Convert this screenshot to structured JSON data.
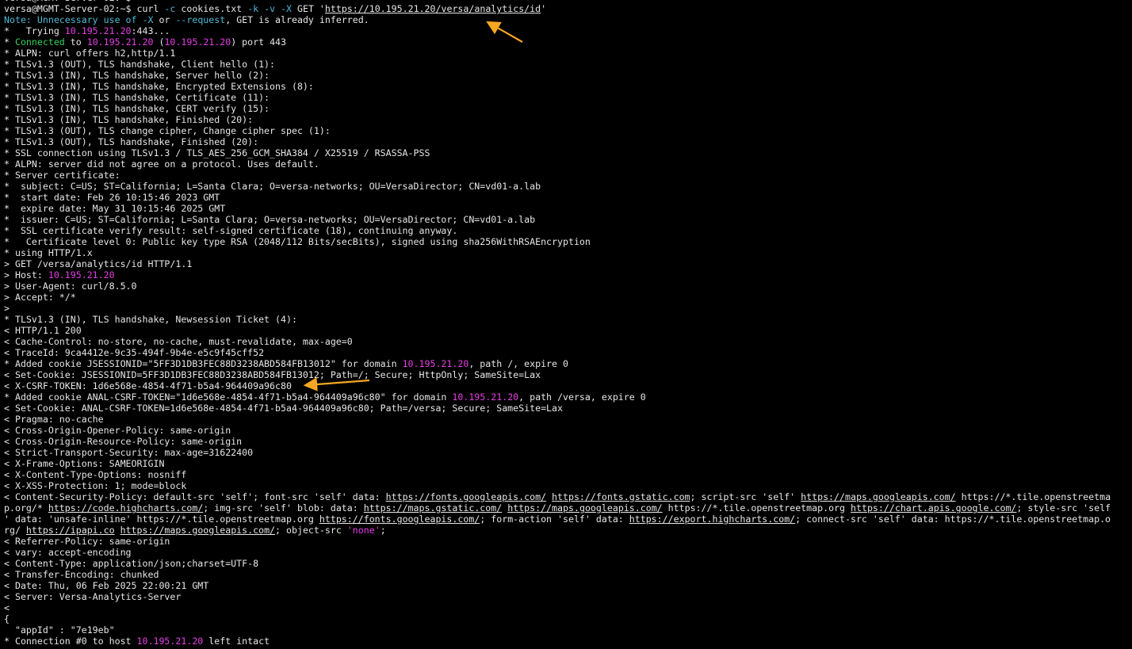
{
  "terminal": {
    "lines": [
      [
        {
          "t": "versa@MGMT-Server-02:~$ ",
          "c": "prompt"
        }
      ],
      [
        {
          "t": "versa@MGMT-Server-02:~$ curl ",
          "c": "prompt"
        },
        {
          "t": "-c",
          "c": "flag"
        },
        {
          "t": " cookies.txt ",
          "c": "plain"
        },
        {
          "t": "-k",
          "c": "flag"
        },
        {
          "t": " ",
          "c": "plain"
        },
        {
          "t": "-v",
          "c": "flag"
        },
        {
          "t": " ",
          "c": "plain"
        },
        {
          "t": "-X",
          "c": "flag"
        },
        {
          "t": " GET '",
          "c": "plain"
        },
        {
          "t": "https://10.195.21.20/versa/analytics/id",
          "c": "link"
        },
        {
          "t": "'",
          "c": "plain"
        }
      ],
      [
        {
          "t": "Note: Unnecessary use of ",
          "c": "note"
        },
        {
          "t": "-X",
          "c": "flag"
        },
        {
          "t": " or ",
          "c": "plain"
        },
        {
          "t": "--request",
          "c": "flag"
        },
        {
          "t": ", GET is already inferred.",
          "c": "plain"
        }
      ],
      [
        {
          "t": "*   Trying ",
          "c": "plain"
        },
        {
          "t": "10.195.21.20",
          "c": "ip"
        },
        {
          "t": ":443...",
          "c": "plain"
        }
      ],
      [
        {
          "t": "* ",
          "c": "plain"
        },
        {
          "t": "Connected",
          "c": "green"
        },
        {
          "t": " to ",
          "c": "plain"
        },
        {
          "t": "10.195.21.20",
          "c": "ip"
        },
        {
          "t": " (",
          "c": "plain"
        },
        {
          "t": "10.195.21.20",
          "c": "ip"
        },
        {
          "t": ") port 443",
          "c": "plain"
        }
      ],
      [
        {
          "t": "* ALPN: curl offers h2,http/1.1",
          "c": "plain"
        }
      ],
      [
        {
          "t": "* TLSv1.3 (OUT), TLS handshake, Client hello (1):",
          "c": "plain"
        }
      ],
      [
        {
          "t": "* TLSv1.3 (IN), TLS handshake, Server hello (2):",
          "c": "plain"
        }
      ],
      [
        {
          "t": "* TLSv1.3 (IN), TLS handshake, Encrypted Extensions (8):",
          "c": "plain"
        }
      ],
      [
        {
          "t": "* TLSv1.3 (IN), TLS handshake, Certificate (11):",
          "c": "plain"
        }
      ],
      [
        {
          "t": "* TLSv1.3 (IN), TLS handshake, CERT verify (15):",
          "c": "plain"
        }
      ],
      [
        {
          "t": "* TLSv1.3 (IN), TLS handshake, Finished (20):",
          "c": "plain"
        }
      ],
      [
        {
          "t": "* TLSv1.3 (OUT), TLS change cipher, Change cipher spec (1):",
          "c": "plain"
        }
      ],
      [
        {
          "t": "* TLSv1.3 (OUT), TLS handshake, Finished (20):",
          "c": "plain"
        }
      ],
      [
        {
          "t": "* SSL connection using TLSv1.3 / TLS_AES_256_GCM_SHA384 / X25519 / RSASSA-PSS",
          "c": "plain"
        }
      ],
      [
        {
          "t": "* ALPN: server did not agree on a protocol. Uses default.",
          "c": "plain"
        }
      ],
      [
        {
          "t": "* Server certificate:",
          "c": "plain"
        }
      ],
      [
        {
          "t": "*  subject: C=US; ST=California; L=Santa Clara; O=versa-networks; OU=VersaDirector; CN=vd01-a.lab",
          "c": "plain"
        }
      ],
      [
        {
          "t": "*  start date: Feb 26 10:15:46 2023 GMT",
          "c": "plain"
        }
      ],
      [
        {
          "t": "*  expire date: May 31 10:15:46 2025 GMT",
          "c": "plain"
        }
      ],
      [
        {
          "t": "*  issuer: C=US; ST=California; L=Santa Clara; O=versa-networks; OU=VersaDirector; CN=vd01-a.lab",
          "c": "plain"
        }
      ],
      [
        {
          "t": "*  SSL certificate verify result: self-signed certificate (18), continuing anyway.",
          "c": "plain"
        }
      ],
      [
        {
          "t": "*   Certificate level 0: Public key type RSA (2048/112 Bits/secBits), signed using sha256WithRSAEncryption",
          "c": "plain"
        }
      ],
      [
        {
          "t": "* using HTTP/1.x",
          "c": "plain"
        }
      ],
      [
        {
          "t": "> GET /versa/analytics/id HTTP/1.1",
          "c": "plain"
        }
      ],
      [
        {
          "t": "> Host: ",
          "c": "plain"
        },
        {
          "t": "10.195.21.20",
          "c": "ip"
        }
      ],
      [
        {
          "t": "> User-Agent: curl/8.5.0",
          "c": "plain"
        }
      ],
      [
        {
          "t": "> Accept: */*",
          "c": "plain"
        }
      ],
      [
        {
          "t": ">",
          "c": "plain"
        }
      ],
      [
        {
          "t": "* TLSv1.3 (IN), TLS handshake, Newsession Ticket (4):",
          "c": "plain"
        }
      ],
      [
        {
          "t": "< HTTP/1.1 200",
          "c": "plain"
        }
      ],
      [
        {
          "t": "< Cache-Control: no-store, no-cache, must-revalidate, max-age=0",
          "c": "plain"
        }
      ],
      [
        {
          "t": "< TraceId: 9ca4412e-9c35-494f-9b4e-e5c9f45cff52",
          "c": "plain"
        }
      ],
      [
        {
          "t": "* Added cookie JSESSIONID=\"5FF3D1DB3FEC88D3238ABD584FB13012\" for domain ",
          "c": "plain"
        },
        {
          "t": "10.195.21.20",
          "c": "ip"
        },
        {
          "t": ", path /, expire 0",
          "c": "plain"
        }
      ],
      [
        {
          "t": "< Set-Cookie: JSESSIONID=5FF3D1DB3FEC88D3238ABD584FB13012; Path=/; Secure; HttpOnly; SameSite=Lax",
          "c": "plain"
        }
      ],
      [
        {
          "t": "< X-CSRF-TOKEN: 1d6e568e-4854-4f71-b5a4-964409a96c80",
          "c": "plain"
        }
      ],
      [
        {
          "t": "* Added cookie ANAL-CSRF-TOKEN=\"1d6e568e-4854-4f71-b5a4-964409a96c80\" for domain ",
          "c": "plain"
        },
        {
          "t": "10.195.21.20",
          "c": "ip"
        },
        {
          "t": ", path /versa, expire 0",
          "c": "plain"
        }
      ],
      [
        {
          "t": "< Set-Cookie: ANAL-CSRF-TOKEN=1d6e568e-4854-4f71-b5a4-964409a96c80; Path=/versa; Secure; SameSite=Lax",
          "c": "plain"
        }
      ],
      [
        {
          "t": "< Pragma: no-cache",
          "c": "plain"
        }
      ],
      [
        {
          "t": "< Cross-Origin-Opener-Policy: same-origin",
          "c": "plain"
        }
      ],
      [
        {
          "t": "< Cross-Origin-Resource-Policy: same-origin",
          "c": "plain"
        }
      ],
      [
        {
          "t": "< Strict-Transport-Security: max-age=31622400",
          "c": "plain"
        }
      ],
      [
        {
          "t": "< X-Frame-Options: SAMEORIGIN",
          "c": "plain"
        }
      ],
      [
        {
          "t": "< X-Content-Type-Options: nosniff",
          "c": "plain"
        }
      ],
      [
        {
          "t": "< X-XSS-Protection: 1; mode=block",
          "c": "plain"
        }
      ],
      [
        {
          "t": "< Content-Security-Policy: default-src 'self'; font-src 'self' data: ",
          "c": "plain"
        },
        {
          "t": "https://fonts.googleapis.com/",
          "c": "link"
        },
        {
          "t": " ",
          "c": "plain"
        },
        {
          "t": "https://fonts.gstatic.com",
          "c": "link"
        },
        {
          "t": "; script-src 'self' ",
          "c": "plain"
        },
        {
          "t": "https://maps.googleapis.com/",
          "c": "link"
        },
        {
          "t": " https://*.tile.openstreetma",
          "c": "plain"
        }
      ],
      [
        {
          "t": "p.org/* ",
          "c": "plain"
        },
        {
          "t": "https://code.highcharts.com/",
          "c": "link"
        },
        {
          "t": "; img-src 'self' blob: data: ",
          "c": "plain"
        },
        {
          "t": "https://maps.gstatic.com/",
          "c": "link"
        },
        {
          "t": " ",
          "c": "plain"
        },
        {
          "t": "https://maps.googleapis.com/",
          "c": "link"
        },
        {
          "t": " https://*.tile.openstreetmap.org ",
          "c": "plain"
        },
        {
          "t": "https://chart.apis.google.com/",
          "c": "link"
        },
        {
          "t": "; style-src 'self",
          "c": "plain"
        }
      ],
      [
        {
          "t": "' data: 'unsafe-inline' https://*.tile.openstreetmap.org ",
          "c": "plain"
        },
        {
          "t": "https://fonts.googleapis.com/",
          "c": "link"
        },
        {
          "t": "; form-action 'self' data: ",
          "c": "plain"
        },
        {
          "t": "https://export.highcharts.com/",
          "c": "link"
        },
        {
          "t": "; connect-src 'self' data: https://*.tile.openstreetmap.o",
          "c": "plain"
        }
      ],
      [
        {
          "t": "rg/ ",
          "c": "plain"
        },
        {
          "t": "https://ipapi.co",
          "c": "link"
        },
        {
          "t": " ",
          "c": "plain"
        },
        {
          "t": "https://maps.googleapis.com/",
          "c": "link"
        },
        {
          "t": "; object-src ",
          "c": "plain"
        },
        {
          "t": "'none'",
          "c": "none"
        },
        {
          "t": ";",
          "c": "plain"
        }
      ],
      [
        {
          "t": "< Referrer-Policy: same-origin",
          "c": "plain"
        }
      ],
      [
        {
          "t": "< vary: accept-encoding",
          "c": "plain"
        }
      ],
      [
        {
          "t": "< Content-Type: application/json;charset=UTF-8",
          "c": "plain"
        }
      ],
      [
        {
          "t": "< Transfer-Encoding: chunked",
          "c": "plain"
        }
      ],
      [
        {
          "t": "< Date: Thu, 06 Feb 2025 22:00:21 GMT",
          "c": "plain"
        }
      ],
      [
        {
          "t": "< Server: Versa-Analytics-Server",
          "c": "plain"
        }
      ],
      [
        {
          "t": "<",
          "c": "plain"
        }
      ],
      [
        {
          "t": "{",
          "c": "plain"
        }
      ],
      [
        {
          "t": "  \"appId\" : \"7e19eb\"",
          "c": "plain"
        }
      ],
      [
        {
          "t": "* Connection #0 to host ",
          "c": "plain"
        },
        {
          "t": "10.195.21.20",
          "c": "ip"
        },
        {
          "t": " left intact",
          "c": "plain"
        }
      ]
    ]
  },
  "colors": {
    "background": "#000000",
    "text": "#e6e6e6",
    "ip": "#e53ee5",
    "connected": "#35d35a",
    "note": "#4fb8d6",
    "arrow": "#f5a623"
  },
  "annotations": {
    "arrows": [
      {
        "name": "url-arrow",
        "points_to": "https://10.195.21.20/versa/analytics/id"
      },
      {
        "name": "csrf-token-arrow",
        "points_to": "X-CSRF-TOKEN: 1d6e568e-4854-4f71-b5a4-964409a96c80"
      }
    ]
  }
}
